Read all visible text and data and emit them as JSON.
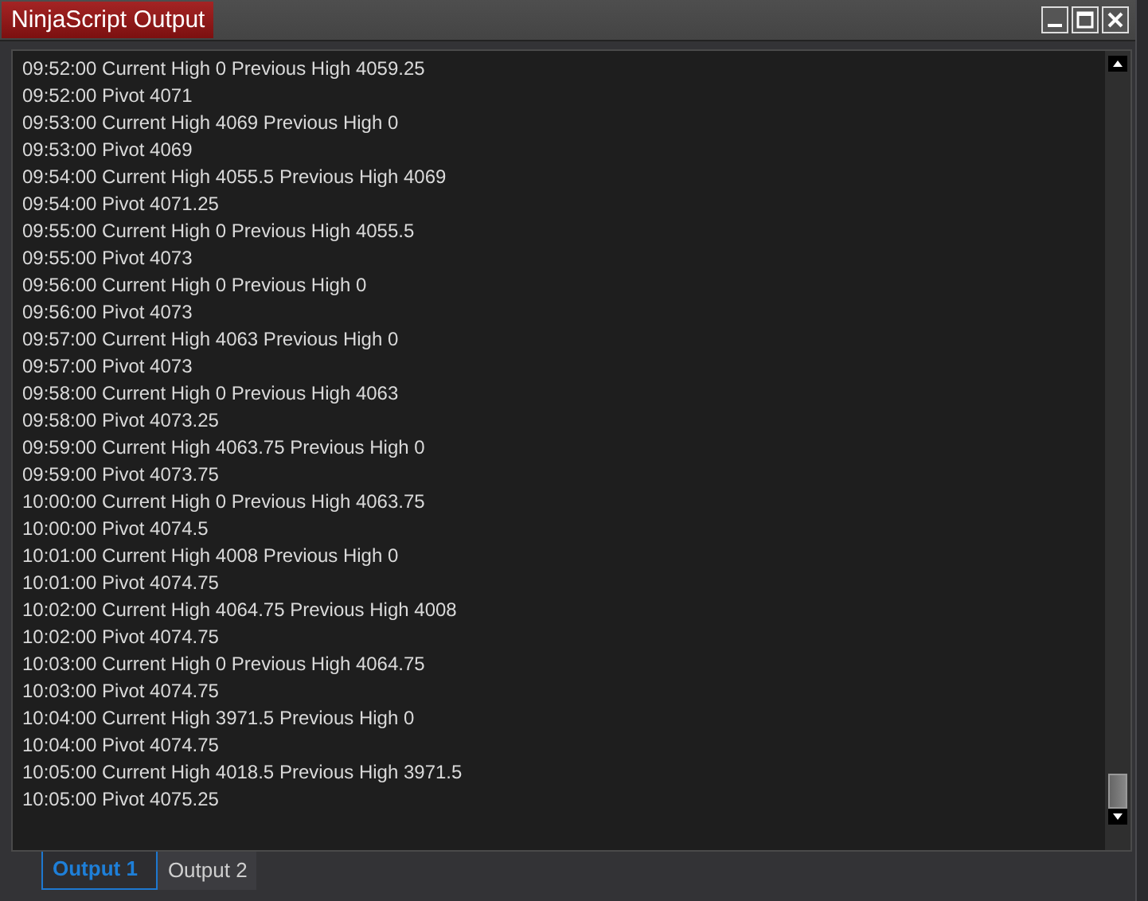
{
  "window": {
    "title": "NinjaScript Output"
  },
  "output_lines": [
    "09:52:00 Current High 0 Previous High 4059.25",
    "09:52:00 Pivot 4071",
    "09:53:00 Current High 4069 Previous High 0",
    "09:53:00 Pivot 4069",
    "09:54:00 Current High 4055.5 Previous High 4069",
    "09:54:00 Pivot 4071.25",
    "09:55:00 Current High 0 Previous High 4055.5",
    "09:55:00 Pivot 4073",
    "09:56:00 Current High 0 Previous High 0",
    "09:56:00 Pivot 4073",
    "09:57:00 Current High 4063 Previous High 0",
    "09:57:00 Pivot 4073",
    "09:58:00 Current High 0 Previous High 4063",
    "09:58:00 Pivot 4073.25",
    "09:59:00 Current High 4063.75 Previous High 0",
    "09:59:00 Pivot 4073.75",
    "10:00:00 Current High 0 Previous High 4063.75",
    "10:00:00 Pivot 4074.5",
    "10:01:00 Current High 4008 Previous High 0",
    "10:01:00 Pivot 4074.75",
    "10:02:00 Current High 4064.75 Previous High 4008",
    "10:02:00 Pivot 4074.75",
    "10:03:00 Current High 0 Previous High 4064.75",
    "10:03:00 Pivot 4074.75",
    "10:04:00 Current High 3971.5 Previous High 0",
    "10:04:00 Pivot 4074.75",
    "10:05:00 Current High 4018.5 Previous High 3971.5",
    "10:05:00 Pivot 4075.25"
  ],
  "tabs": [
    {
      "label": "Output 1",
      "selected": true
    },
    {
      "label": "Output 2",
      "selected": false
    }
  ]
}
